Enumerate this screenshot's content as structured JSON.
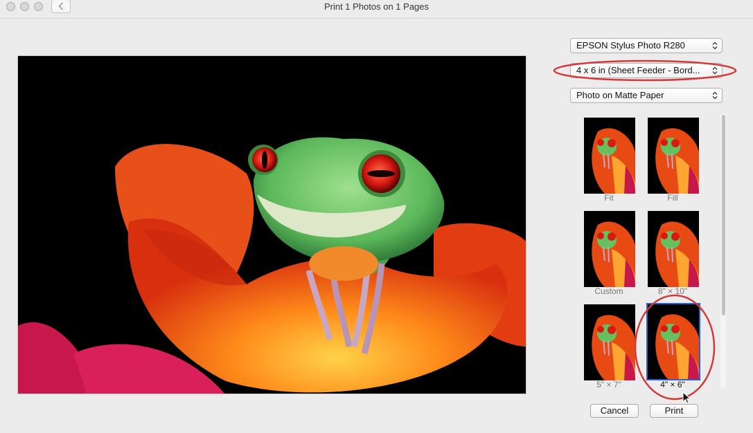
{
  "window": {
    "title": "Print 1 Photos on 1 Pages"
  },
  "printer": {
    "selected": "EPSON Stylus Photo R280"
  },
  "paper_size": {
    "selected": "4 x 6 in (Sheet Feeder - Bord..."
  },
  "paper_type": {
    "selected": "Photo on Matte Paper"
  },
  "layouts": [
    {
      "label": "Fit",
      "selected": false
    },
    {
      "label": "Fill",
      "selected": false
    },
    {
      "label": "Custom",
      "selected": false
    },
    {
      "label": "8\" × 10\"",
      "selected": false
    },
    {
      "label": "5\" × 7\"",
      "selected": false
    },
    {
      "label": "4\" × 6\"",
      "selected": true
    }
  ],
  "buttons": {
    "cancel": "Cancel",
    "print": "Print"
  },
  "colors": {
    "annotation": "#d23a3a",
    "selection": "#2a5fd6"
  }
}
